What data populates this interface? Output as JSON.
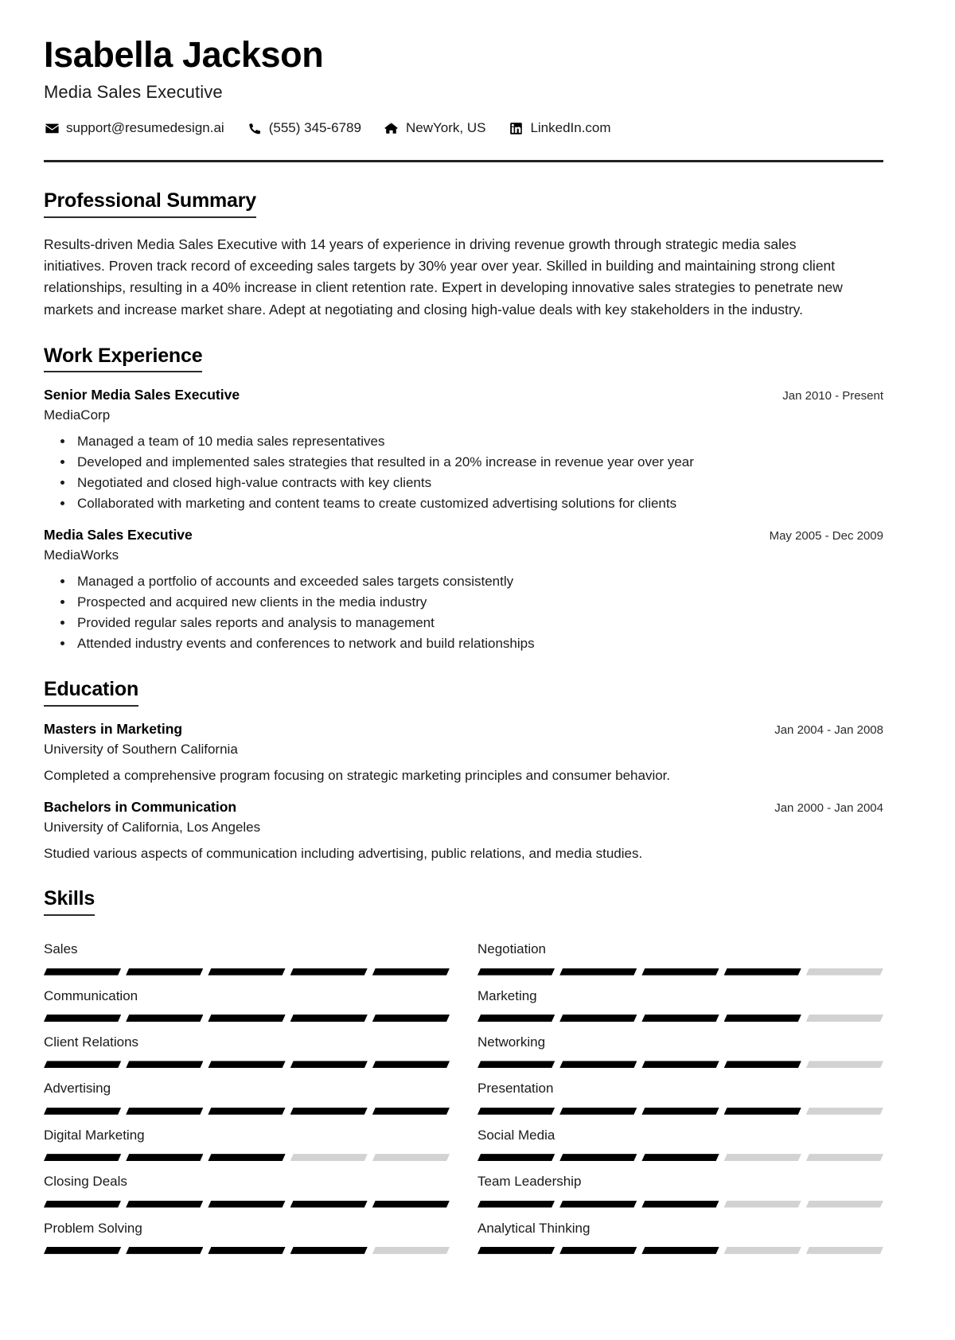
{
  "header": {
    "name": "Isabella Jackson",
    "role": "Media Sales Executive",
    "contacts": [
      {
        "icon": "envelope-icon",
        "text": "support@resumedesign.ai"
      },
      {
        "icon": "phone-icon",
        "text": "(555) 345-6789"
      },
      {
        "icon": "home-icon",
        "text": "NewYork, US"
      },
      {
        "icon": "linkedin-icon",
        "text": "LinkedIn.com"
      }
    ]
  },
  "summary": {
    "title": "Professional Summary",
    "text": "Results-driven Media Sales Executive with 14 years of experience in driving revenue growth through strategic media sales initiatives. Proven track record of exceeding sales targets by 30% year over year. Skilled in building and maintaining strong client relationships, resulting in a 40% increase in client retention rate. Expert in developing innovative sales strategies to penetrate new markets and increase market share. Adept at negotiating and closing high-value deals with key stakeholders in the industry."
  },
  "experience": {
    "title": "Work Experience",
    "items": [
      {
        "title": "Senior Media Sales Executive",
        "date": "Jan 2010 - Present",
        "company": "MediaCorp",
        "bullets": [
          "Managed a team of 10 media sales representatives",
          "Developed and implemented sales strategies that resulted in a 20% increase in revenue year over year",
          "Negotiated and closed high-value contracts with key clients",
          "Collaborated with marketing and content teams to create customized advertising solutions for clients"
        ]
      },
      {
        "title": "Media Sales Executive",
        "date": "May 2005 - Dec 2009",
        "company": "MediaWorks",
        "bullets": [
          "Managed a portfolio of accounts and exceeded sales targets consistently",
          "Prospected and acquired new clients in the media industry",
          "Provided regular sales reports and analysis to management",
          "Attended industry events and conferences to network and build relationships"
        ]
      }
    ]
  },
  "education": {
    "title": "Education",
    "items": [
      {
        "title": "Masters in Marketing",
        "date": "Jan 2004 - Jan 2008",
        "school": "University of Southern California",
        "description": "Completed a comprehensive program focusing on strategic marketing principles and consumer behavior."
      },
      {
        "title": "Bachelors in Communication",
        "date": "Jan 2000 - Jan 2004",
        "school": "University of California, Los Angeles",
        "description": "Studied various aspects of communication including advertising, public relations, and media studies."
      }
    ]
  },
  "skills": {
    "title": "Skills",
    "max_level": 5,
    "filled_color": "#000000",
    "empty_color": "#d2d2d2",
    "items": [
      {
        "name": "Sales",
        "level": 5
      },
      {
        "name": "Negotiation",
        "level": 4
      },
      {
        "name": "Communication",
        "level": 5
      },
      {
        "name": "Marketing",
        "level": 4
      },
      {
        "name": "Client Relations",
        "level": 5
      },
      {
        "name": "Networking",
        "level": 4
      },
      {
        "name": "Advertising",
        "level": 5
      },
      {
        "name": "Presentation",
        "level": 4
      },
      {
        "name": "Digital Marketing",
        "level": 3
      },
      {
        "name": "Social Media",
        "level": 3
      },
      {
        "name": "Closing Deals",
        "level": 5
      },
      {
        "name": "Team Leadership",
        "level": 3
      },
      {
        "name": "Problem Solving",
        "level": 4
      },
      {
        "name": "Analytical Thinking",
        "level": 3
      }
    ]
  }
}
